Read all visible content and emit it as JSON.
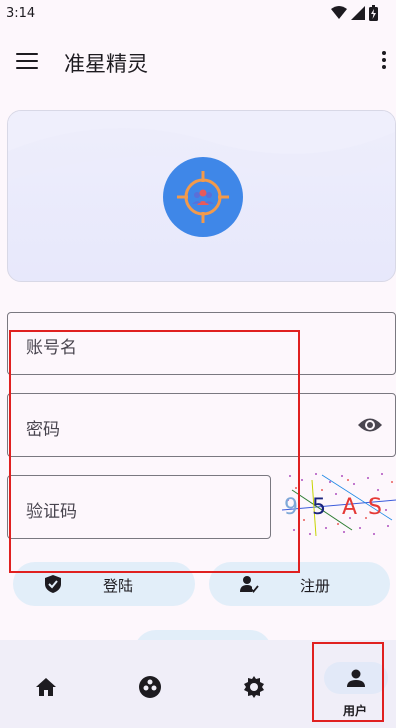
{
  "status_bar": {
    "time": "3:14"
  },
  "app_bar": {
    "title": "准星精灵",
    "menu_icon": "menu-icon",
    "more_icon": "more-vert-icon"
  },
  "banner": {
    "logo_icon": "target-crosshair-icon",
    "accent_color": "#3f87e8"
  },
  "form": {
    "account": {
      "label": "账号名"
    },
    "password": {
      "label": "密码",
      "toggle_icon": "eye-icon"
    },
    "captcha": {
      "label": "验证码",
      "code_chars": [
        "9",
        "5",
        "A",
        "S"
      ]
    }
  },
  "actions": {
    "login_label": "登陆",
    "register_label": "注册"
  },
  "bottom_nav": {
    "items": [
      {
        "icon": "home-icon"
      },
      {
        "icon": "drive-circle-icon"
      },
      {
        "icon": "settings-icon"
      },
      {
        "icon": "person-icon",
        "label": "用户",
        "active": true
      }
    ]
  },
  "colors": {
    "highlight_box": "#e02020",
    "button_bg": "#e2eef9"
  }
}
